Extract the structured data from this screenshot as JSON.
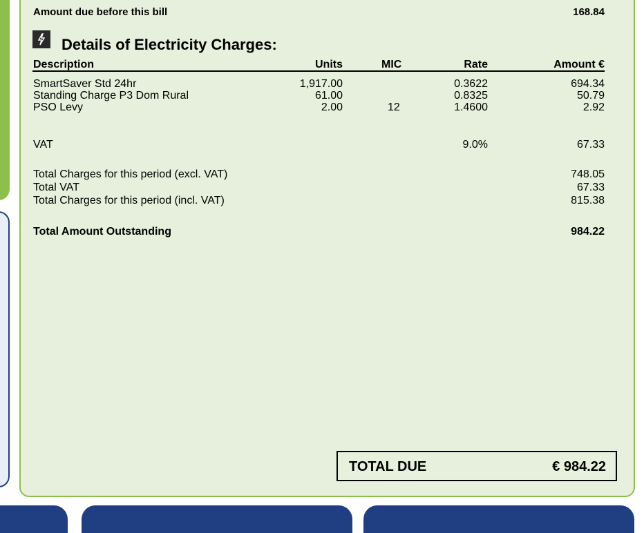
{
  "balance": {
    "label": "Amount due before this bill",
    "amount": "168.84"
  },
  "section": {
    "title": "Details of Electricity Charges:",
    "icon": "lightning-bolt-icon"
  },
  "table": {
    "headers": {
      "description": "Description",
      "units": "Units",
      "mic": "MIC",
      "rate": "Rate",
      "amount": "Amount €"
    },
    "rows": [
      {
        "description": "SmartSaver Std 24hr",
        "units": "1,917.00",
        "mic": "",
        "rate": "0.3622",
        "amount": "694.34"
      },
      {
        "description": "Standing Charge P3 Dom Rural",
        "units": "61.00",
        "mic": "",
        "rate": "0.8325",
        "amount": "50.79"
      },
      {
        "description": "PSO Levy",
        "units": "2.00",
        "mic": "12",
        "rate": "1.4600",
        "amount": "2.92"
      }
    ],
    "vat": {
      "description": "VAT",
      "rate": "9.0%",
      "amount": "67.33"
    }
  },
  "totals": [
    {
      "label": "Total Charges for this period (excl. VAT)",
      "amount": "748.05"
    },
    {
      "label": "Total VAT",
      "amount": "67.33"
    },
    {
      "label": "Total Charges for this period (incl. VAT)",
      "amount": "815.38"
    }
  ],
  "outstanding": {
    "label": "Total Amount Outstanding",
    "amount": "984.22"
  },
  "total_due": {
    "label": "TOTAL DUE",
    "amount": "€ 984.22"
  },
  "colors": {
    "panel_bg": "#e7f0dc",
    "accent_green": "#8cc04a",
    "accent_blue": "#1f3f82"
  }
}
